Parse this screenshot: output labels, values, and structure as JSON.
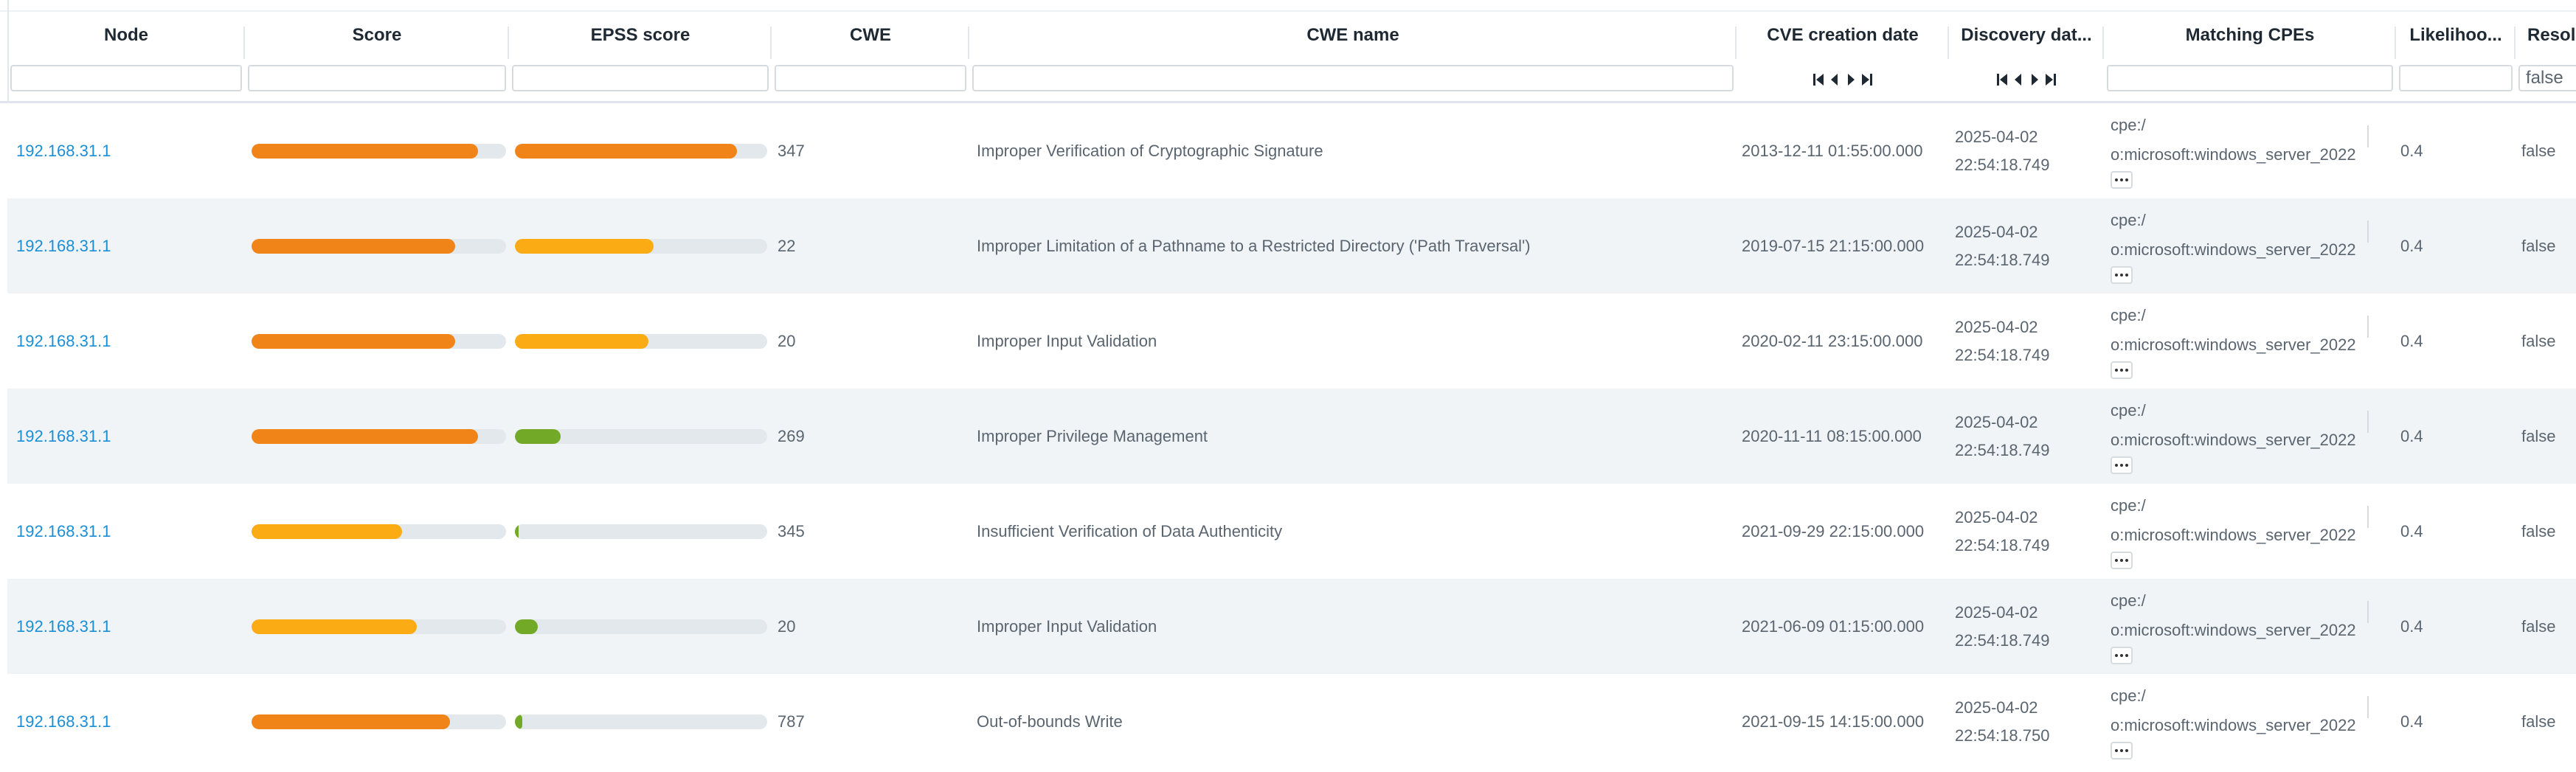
{
  "columns": [
    {
      "key": "node",
      "title": "Node",
      "filter_value": ""
    },
    {
      "key": "score",
      "title": "Score",
      "filter_value": ""
    },
    {
      "key": "epss",
      "title": "EPSS score",
      "filter_value": ""
    },
    {
      "key": "cwe",
      "title": "CWE",
      "filter_value": ""
    },
    {
      "key": "cwe_name",
      "title": "CWE name",
      "filter_value": ""
    },
    {
      "key": "cve_date",
      "title": "CVE creation date"
    },
    {
      "key": "discovery_date",
      "title": "Discovery dat..."
    },
    {
      "key": "cpes",
      "title": "Matching CPEs",
      "filter_value": ""
    },
    {
      "key": "likelihood",
      "title": "Likelihoo...",
      "filter_value": ""
    },
    {
      "key": "resolved",
      "title": "Resol",
      "filter_value": "false"
    }
  ],
  "nav_icons": [
    "first-page-icon",
    "prev-page-icon",
    "next-page-icon",
    "last-page-icon"
  ],
  "colors": {
    "link": "#1c8ed6",
    "bar_high": "#f08419",
    "bar_medium": "#fbab13",
    "bar_low": "#72aa27",
    "bar_track": "#e3e8ec",
    "row_alt": "#f0f4f7"
  },
  "rows": [
    {
      "node": "192.168.31.1",
      "score_fraction": 0.89,
      "score_level": "high",
      "epss_fraction": 0.88,
      "epss_level": "high",
      "cwe": "347",
      "cwe_name": "Improper Verification of Cryptographic Signature",
      "cve_date": "2013-12-11 01:55:00.000",
      "disc_date": "2025-04-02",
      "disc_time": "22:54:18.749",
      "cpe_1": "cpe:/",
      "cpe_2": "o:microsoft:windows_server_2022",
      "likelihood": "0.4",
      "resolved": "false"
    },
    {
      "node": "192.168.31.1",
      "score_fraction": 0.8,
      "score_level": "high",
      "epss_fraction": 0.55,
      "epss_level": "medium",
      "cwe": "22",
      "cwe_name": "Improper Limitation of a Pathname to a Restricted Directory ('Path Traversal')",
      "cve_date": "2019-07-15 21:15:00.000",
      "disc_date": "2025-04-02",
      "disc_time": "22:54:18.749",
      "cpe_1": "cpe:/",
      "cpe_2": "o:microsoft:windows_server_2022",
      "likelihood": "0.4",
      "resolved": "false"
    },
    {
      "node": "192.168.31.1",
      "score_fraction": 0.8,
      "score_level": "high",
      "epss_fraction": 0.53,
      "epss_level": "medium",
      "cwe": "20",
      "cwe_name": "Improper Input Validation",
      "cve_date": "2020-02-11 23:15:00.000",
      "disc_date": "2025-04-02",
      "disc_time": "22:54:18.749",
      "cpe_1": "cpe:/",
      "cpe_2": "o:microsoft:windows_server_2022",
      "likelihood": "0.4",
      "resolved": "false"
    },
    {
      "node": "192.168.31.1",
      "score_fraction": 0.89,
      "score_level": "high",
      "epss_fraction": 0.18,
      "epss_level": "low",
      "cwe": "269",
      "cwe_name": "Improper Privilege Management",
      "cve_date": "2020-11-11 08:15:00.000",
      "disc_date": "2025-04-02",
      "disc_time": "22:54:18.749",
      "cpe_1": "cpe:/",
      "cpe_2": "o:microsoft:windows_server_2022",
      "likelihood": "0.4",
      "resolved": "false"
    },
    {
      "node": "192.168.31.1",
      "score_fraction": 0.59,
      "score_level": "medium",
      "epss_fraction": 0.01,
      "epss_level": "low",
      "cwe": "345",
      "cwe_name": "Insufficient Verification of Data Authenticity",
      "cve_date": "2021-09-29 22:15:00.000",
      "disc_date": "2025-04-02",
      "disc_time": "22:54:18.749",
      "cpe_1": "cpe:/",
      "cpe_2": "o:microsoft:windows_server_2022",
      "likelihood": "0.4",
      "resolved": "false"
    },
    {
      "node": "192.168.31.1",
      "score_fraction": 0.65,
      "score_level": "medium",
      "epss_fraction": 0.09,
      "epss_level": "low",
      "cwe": "20",
      "cwe_name": "Improper Input Validation",
      "cve_date": "2021-06-09 01:15:00.000",
      "disc_date": "2025-04-02",
      "disc_time": "22:54:18.749",
      "cpe_1": "cpe:/",
      "cpe_2": "o:microsoft:windows_server_2022",
      "likelihood": "0.4",
      "resolved": "false"
    },
    {
      "node": "192.168.31.1",
      "score_fraction": 0.78,
      "score_level": "high",
      "epss_fraction": 0.03,
      "epss_level": "low",
      "cwe": "787",
      "cwe_name": "Out-of-bounds Write",
      "cve_date": "2021-09-15 14:15:00.000",
      "disc_date": "2025-04-02",
      "disc_time": "22:54:18.750",
      "cpe_1": "cpe:/",
      "cpe_2": "o:microsoft:windows_server_2022",
      "likelihood": "0.4",
      "resolved": "false"
    }
  ]
}
